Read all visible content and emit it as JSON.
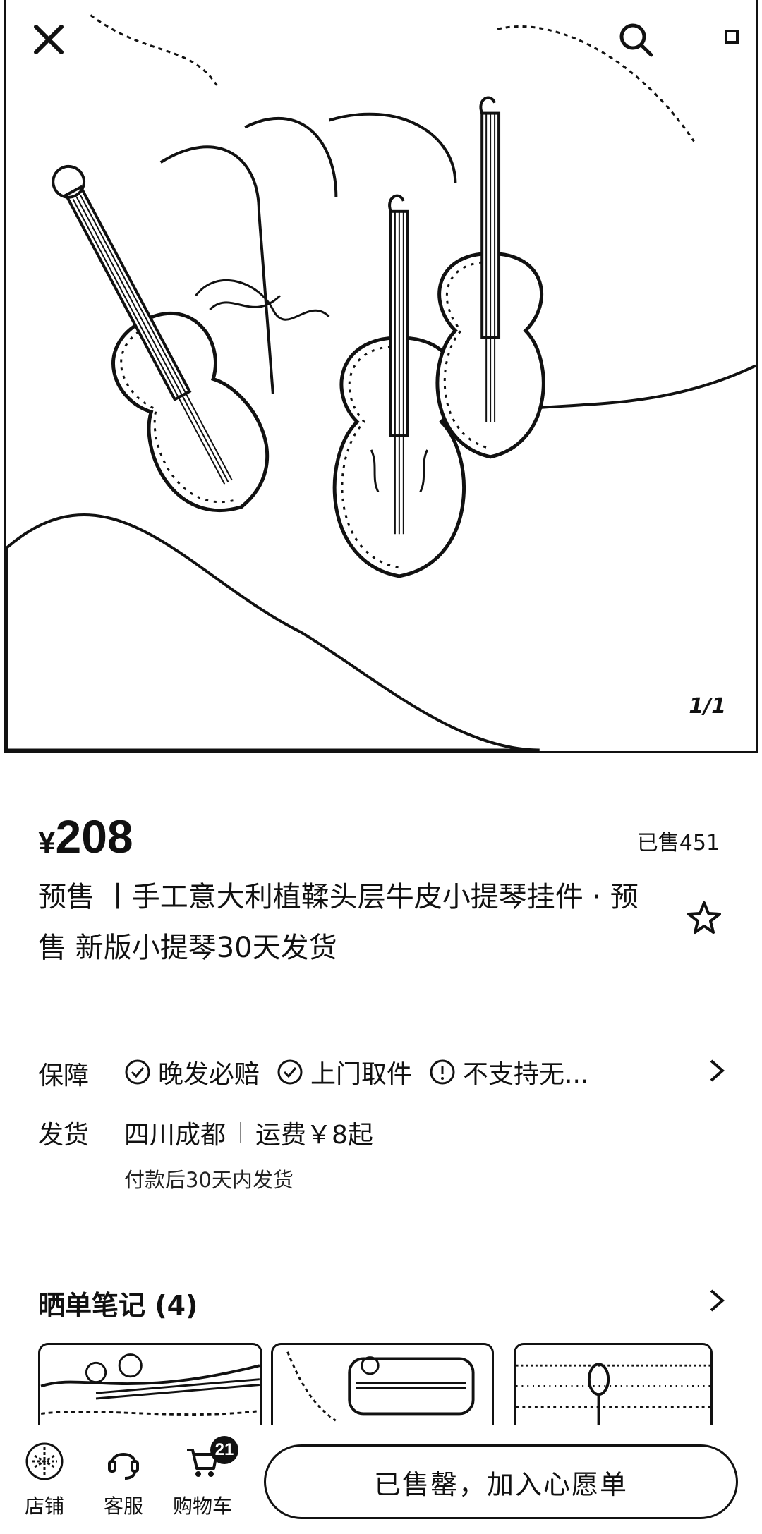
{
  "gallery": {
    "counter": "1/1"
  },
  "product": {
    "currency": "¥",
    "price": "208",
    "sold": "已售451",
    "title": "预售 丨手工意大利植鞣头层牛皮小提琴挂件 · 预售 新版小提琴30天发货"
  },
  "service": {
    "guarantee_label": "保障",
    "guarantees": [
      "晚发必赔",
      "上门取件",
      "不支持无..."
    ],
    "ship_label": "发货",
    "ship_from": "四川成都",
    "ship_fee": "运费￥8起",
    "ship_note": "付款后30天内发货"
  },
  "reviews": {
    "title": "晒单笔记 (4)"
  },
  "bottom_bar": {
    "store_label": "店铺",
    "service_label": "客服",
    "cart_label": "购物车",
    "cart_count": "21",
    "wish_button": "已售罄，加入心愿单"
  },
  "icons": [
    "close-icon",
    "search-icon",
    "more-icon",
    "star-icon",
    "check-circle-icon",
    "alert-circle-icon",
    "chevron-right-icon",
    "store-icon",
    "headset-icon",
    "cart-icon"
  ]
}
